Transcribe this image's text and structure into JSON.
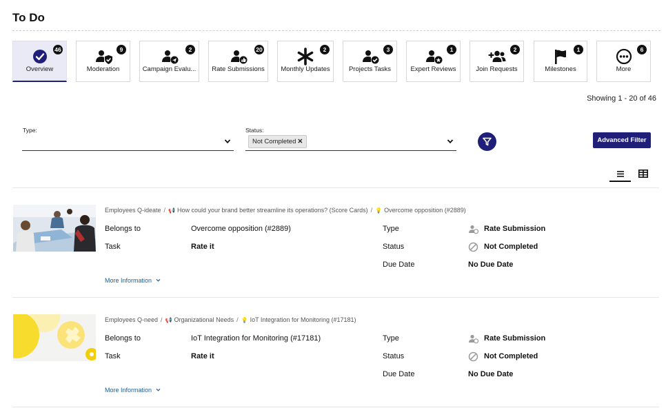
{
  "page": {
    "title": "To Do"
  },
  "tabs": [
    {
      "label": "Overview",
      "count": "46",
      "icon": "check-circle-icon"
    },
    {
      "label": "Moderation",
      "count": "9",
      "icon": "user-shield-icon"
    },
    {
      "label": "Campaign Evalu...",
      "count": "2",
      "icon": "user-send-icon"
    },
    {
      "label": "Rate Submissions",
      "count": "20",
      "icon": "user-thumb-icon"
    },
    {
      "label": "Monthly Updates",
      "count": "2",
      "icon": "asterisk-icon"
    },
    {
      "label": "Projects Tasks",
      "count": "3",
      "icon": "user-check-icon"
    },
    {
      "label": "Expert Reviews",
      "count": "1",
      "icon": "user-star-icon"
    },
    {
      "label": "Join Requests",
      "count": "2",
      "icon": "user-add-group-icon"
    },
    {
      "label": "Milestones",
      "count": "1",
      "icon": "flag-icon"
    },
    {
      "label": "More",
      "count": "6",
      "icon": "more-dots-icon"
    }
  ],
  "results": {
    "showing": "Showing 1 - 20 of 46"
  },
  "filters": {
    "type_label": "Type:",
    "status_label": "Status:",
    "status_chip": "Not Completed",
    "advanced_label": "Advanced Filter"
  },
  "labels": {
    "belongs_to": "Belongs to",
    "task": "Task",
    "type": "Type",
    "status": "Status",
    "due_date": "Due Date",
    "more_info": "More Information"
  },
  "items": [
    {
      "crumbs": [
        "Employees Q-ideate",
        "How could your brand better streamline its operations? (Score Cards)",
        "Overcome opposition (#2889)"
      ],
      "belongs_to": "Overcome opposition (#2889)",
      "task": "Rate it",
      "type": "Rate Submission",
      "status": "Not Completed",
      "due_date": "No Due Date"
    },
    {
      "crumbs": [
        "Employees Q-need",
        "Organizational Needs",
        "IoT Integration for Monitoring (#17181)"
      ],
      "belongs_to": "IoT Integration for Monitoring (#17181)",
      "task": "Rate it",
      "type": "Rate Submission",
      "status": "Not Completed",
      "due_date": "No Due Date"
    }
  ],
  "colors": {
    "accent": "#1f1f7a",
    "link": "#1f5c99",
    "badge": "#111111"
  }
}
